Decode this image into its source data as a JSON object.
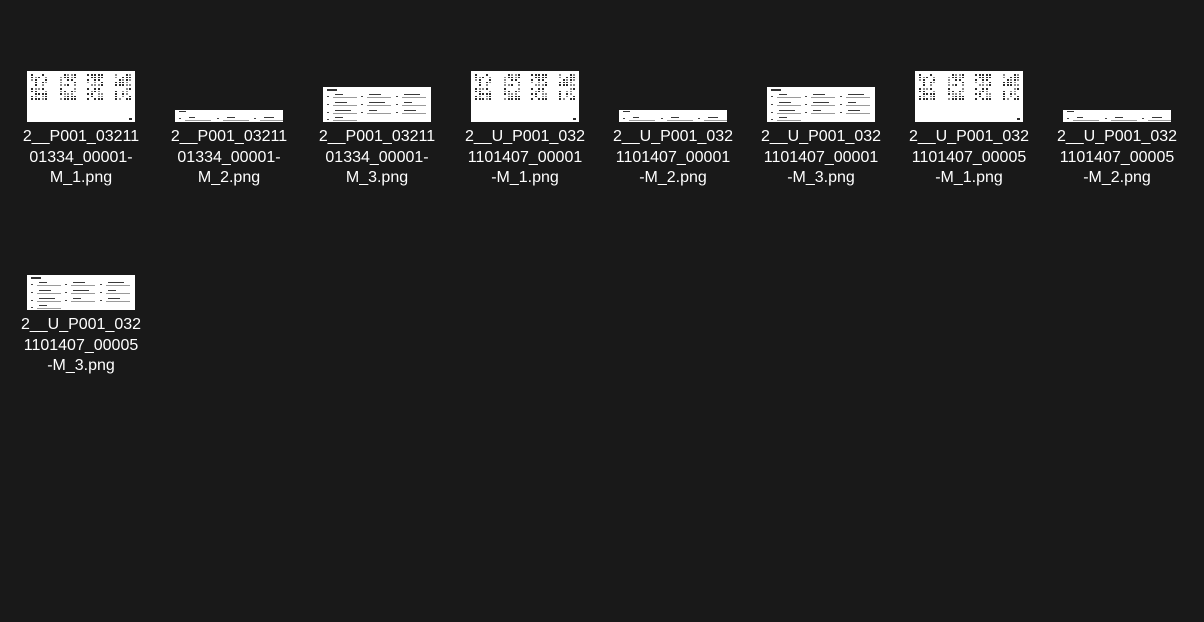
{
  "folder": {
    "files": [
      {
        "name_lines": [
          "2__P001_03211",
          "01334_00001-",
          "M_1.png"
        ],
        "thumb": "grid"
      },
      {
        "name_lines": [
          "2__P001_03211",
          "01334_00001-",
          "M_2.png"
        ],
        "thumb": "form2"
      },
      {
        "name_lines": [
          "2__P001_03211",
          "01334_00001-",
          "M_3.png"
        ],
        "thumb": "form3"
      },
      {
        "name_lines": [
          "2__U_P001_032",
          "1101407_00001",
          "-M_1.png"
        ],
        "thumb": "grid"
      },
      {
        "name_lines": [
          "2__U_P001_032",
          "1101407_00001",
          "-M_2.png"
        ],
        "thumb": "form2"
      },
      {
        "name_lines": [
          "2__U_P001_032",
          "1101407_00001",
          "-M_3.png"
        ],
        "thumb": "form3"
      },
      {
        "name_lines": [
          "2__U_P001_032",
          "1101407_00005",
          "-M_1.png"
        ],
        "thumb": "grid"
      },
      {
        "name_lines": [
          "2__U_P001_032",
          "1101407_00005",
          "-M_2.png"
        ],
        "thumb": "form2"
      },
      {
        "name_lines": [
          "2__U_P001_032",
          "1101407_00005",
          "-M_3.png"
        ],
        "thumb": "form3"
      }
    ]
  }
}
